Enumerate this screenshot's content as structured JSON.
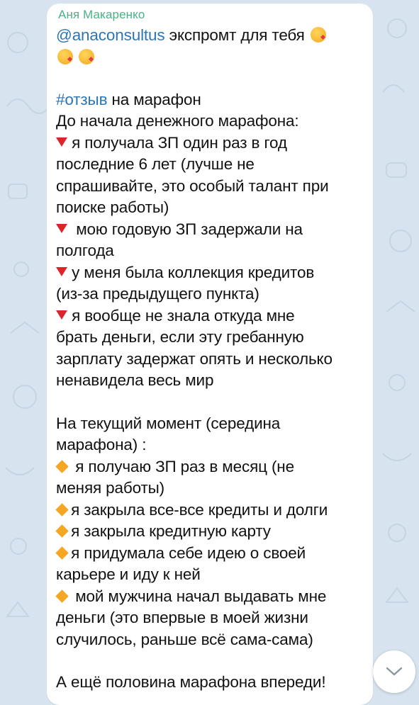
{
  "message": {
    "sender": "Аня Макаренко",
    "mention": "@anaconsultus",
    "greeting": "экспромт для тебя",
    "hashtag": "#отзыв",
    "hashtag_suffix": "на марафон",
    "before_title": "До начала денежного марафона:",
    "b1_l1": "я получала ЗП один раз в год",
    "b1_l2": "последние 6 лет (лучше не",
    "b1_l3": "спрашивайте, это особый талант при",
    "b1_l4": "поиске работы)",
    "b2_l1": "мою годовую ЗП задержали на",
    "b2_l2": "полгода",
    "b3_l1": "у меня была коллекция кредитов",
    "b3_l2": "(из-за предыдущего пункта)",
    "b4_l1": "я вообще не знала откуда мне",
    "b4_l2": "брать деньги, если эту гребанную",
    "b4_l3": "зарплату задержат опять и несколько",
    "b4_l4": "ненавидела весь мир",
    "now_l1": "На текущий момент (середина",
    "now_l2": "марафона) :",
    "c1_l1": "я получаю ЗП раз в месяц (не",
    "c1_l2": "меняя работы)",
    "c2": "я закрыла все-все кредиты и долги",
    "c3": "я закрыла кредитную карту",
    "c4_l1": "я придумала себе идею о своей",
    "c4_l2": "карьере и иду к ней",
    "c5_l1": "мой мужчина начал выдавать мне",
    "c5_l2": "деньги (это впервые в моей жизни",
    "c5_l3": "случилось, раньше всё сама-сама)",
    "closing": "А ещё половина марафона впереди!"
  },
  "icons": {
    "emoji": "kissing-face-emoji",
    "bullet_before": "red-triangle-down",
    "bullet_now": "orange-diamond",
    "scroll": "chevron-down-icon"
  },
  "colors": {
    "background": "#d7e3ee",
    "sender": "#4ab184",
    "link": "#2b76b8",
    "red_bullet": "#d8262b",
    "orange_bullet": "#f5a623"
  }
}
